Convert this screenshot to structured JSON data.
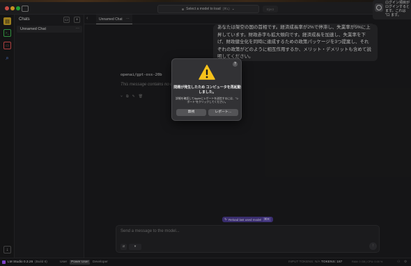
{
  "window": {
    "model_selector": "Select a model to load",
    "model_selector_shortcut": "(⌘L)",
    "eject_label": "Eject"
  },
  "notification": {
    "text": "ログイン項目が ログインすると ます。これは \"ロ ます。"
  },
  "rail": {
    "icons": [
      "chat-icon",
      "terminal-icon",
      "folder-icon",
      "search-icon",
      "download-icon"
    ]
  },
  "chats": {
    "title": "Chats",
    "items": [
      {
        "label": "Unnamed Chat"
      }
    ]
  },
  "tabs": [
    {
      "label": "Unnamed Chat"
    }
  ],
  "conversation": {
    "user_message": "あなたは架空の国の首相です。経済成長率が2%で停滞し、失業率が5%に上昇しています。財政赤字も拡大傾向です。経済成長を加速し、失業率を下げ、財政健全化を同時に達成するための政策パッケージを3つ提案し、それぞれの政策がどのように相互作用するか、メリット・デメリットも含めて説明してください。",
    "assistant_model": "openai/gpt-oss-20b",
    "assistant_message": "This message contains no content."
  },
  "reload_button": {
    "label": "Reload last used model",
    "shortcut": "⌘R"
  },
  "composer": {
    "placeholder": "Send a message to the model...",
    "tools_label": "▾"
  },
  "statusbar": {
    "app_name": "LM Studio 0.3.26",
    "build": "(Build 6)",
    "modes": [
      "User",
      "Power User",
      "Developer"
    ],
    "selected_mode": "Power User",
    "input_tokens": "INPUT TOKENS: N/A",
    "tokens": "TOKENS: 187",
    "ram_cpu": "RAM: 0 GB | CPU: 0.00 %"
  },
  "alert": {
    "title": "問題が発生したため コンピュータを再起動しました。",
    "body": "詳細を確認してAppleにレポートを送信するには、\"レポート\"をクリックしてください。",
    "ignore_label": "無視",
    "report_label": "レポート…"
  }
}
